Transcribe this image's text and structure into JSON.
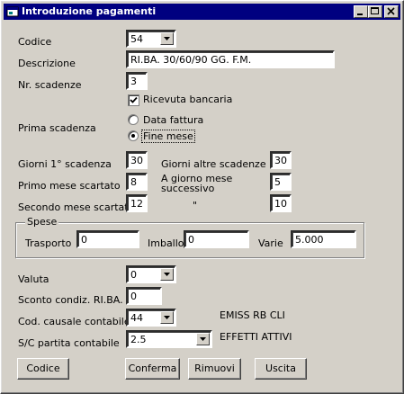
{
  "window": {
    "title": "Introduzione pagamenti"
  },
  "labels": {
    "codice": "Codice",
    "descrizione": "Descrizione",
    "nr_scadenze": "Nr. scadenze",
    "ricevuta": "Ricevuta bancaria",
    "prima_scadenza": "Prima scadenza",
    "data_fattura": "Data fattura",
    "fine_mese": "Fine mese",
    "giorni_prima": "Giorni 1° scadenza",
    "giorni_altre": "Giorni altre scadenze",
    "primo_mese": "Primo mese scartato",
    "a_giorno_1": "A giorno mese",
    "a_giorno_2": "successivo",
    "secondo_mese": "Secondo mese scartato",
    "ditto": "\"",
    "spese": "Spese",
    "trasporto": "Trasporto",
    "imballo": "Imballo",
    "varie": "Varie",
    "valuta": "Valuta",
    "sconto": "Sconto condiz. RI.BA.",
    "causale": "Cod. causale contabile",
    "sc_partita": "S/C partita contabile",
    "causale_desc": "EMISS RB CLI",
    "partita_desc": "EFFETTI ATTIVI"
  },
  "values": {
    "codice": "54",
    "descrizione": "RI.BA. 30/60/90 GG. F.M.",
    "nr_scadenze": "3",
    "giorni_prima": "30",
    "giorni_altre": "30",
    "primo_mese": "8",
    "a_giorno": "5",
    "secondo_mese": "12",
    "secondo_giorno": "10",
    "trasporto": "0",
    "imballo": "0",
    "varie": "5.000",
    "valuta": "0",
    "sconto": "0",
    "causale": "44",
    "sc_partita": "2.5"
  },
  "buttons": {
    "codice": "Codice",
    "conferma": "Conferma",
    "rimuovi": "Rimuovi",
    "uscita": "Uscita"
  },
  "colors": {
    "titlebar": "#000080",
    "face": "#d4d0c8"
  }
}
